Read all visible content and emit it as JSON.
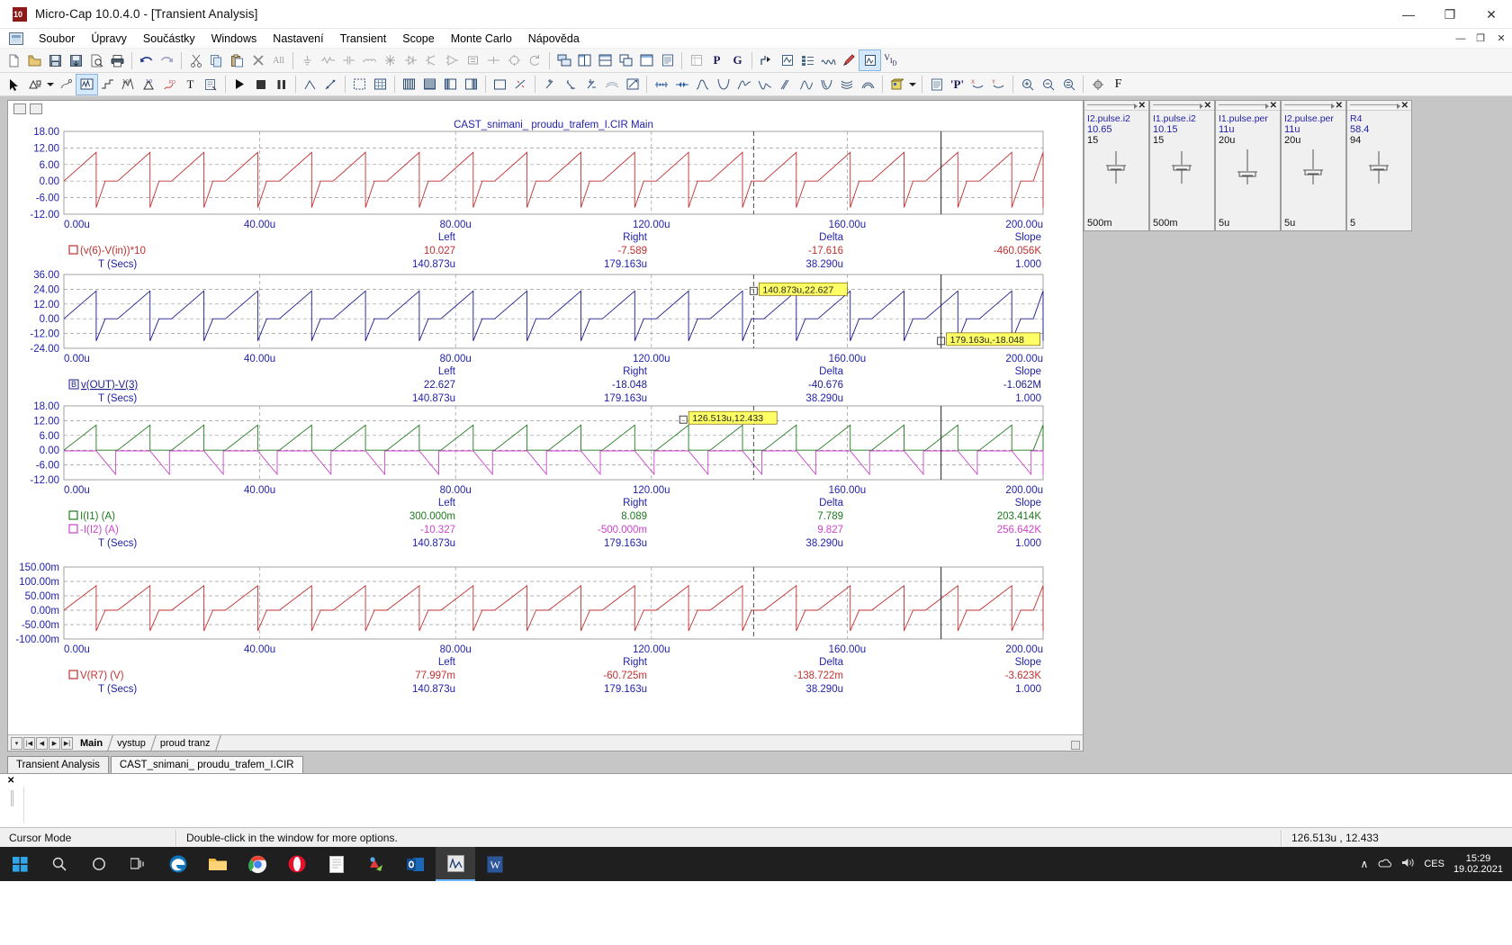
{
  "window": {
    "title": "Micro-Cap 10.0.4.0 - [Transient Analysis]",
    "app_icon": "microcap-icon",
    "minimize": "—",
    "maximize": "❐",
    "close": "✕",
    "inner_minimize": "—",
    "inner_restore": "❐",
    "inner_close": "✕"
  },
  "menu": {
    "items": [
      {
        "label": "Soubor",
        "name": "menu-soubor"
      },
      {
        "label": "Úpravy",
        "name": "menu-upravy"
      },
      {
        "label": "Součástky",
        "name": "menu-soucastky"
      },
      {
        "label": "Windows",
        "name": "menu-windows"
      },
      {
        "label": "Nastavení",
        "name": "menu-nastaveni"
      },
      {
        "label": "Transient",
        "name": "menu-transient"
      },
      {
        "label": "Scope",
        "name": "menu-scope"
      },
      {
        "label": "Monte Carlo",
        "name": "menu-montecarlo"
      },
      {
        "label": "Nápověda",
        "name": "menu-napoveda"
      }
    ]
  },
  "toolbar_labels": {
    "p": "P",
    "g": "G",
    "vid": "V",
    "vid_sub": "I",
    "vid_sub2": "D",
    "f": "F",
    "pquote": "'P'"
  },
  "plot_window": {
    "title": "CAST_snimani_ proudu_trafem_I.CIR Main"
  },
  "chart_data": [
    {
      "id": "plot1",
      "type": "line",
      "title": "CAST_snimani_ proudu_trafem_I.CIR Main",
      "xlabel": "T (Secs)",
      "ylabel": "",
      "ylim": [
        -12,
        18
      ],
      "yticks": [
        "18.00",
        "12.00",
        "6.00",
        "0.00",
        "-6.00",
        "-12.00"
      ],
      "ytick_values": [
        18,
        12,
        6,
        0,
        -6,
        -12
      ],
      "xlim": [
        0,
        200
      ],
      "xticks": [
        "0.00u",
        "40.00u",
        "80.00u",
        "120.00u",
        "160.00u",
        "200.00u"
      ],
      "xtick_values": [
        0,
        40,
        80,
        120,
        160,
        200
      ],
      "series": [
        {
          "name": "(v(6)-V(in))*10",
          "color": "#c03030",
          "period_us": 11,
          "rise_peak": 10.4,
          "fall_min": -9.6,
          "waveform": "sawtooth-pulse"
        }
      ],
      "readout": {
        "columns": [
          "Left",
          "Right",
          "Delta",
          "Slope"
        ],
        "rows": [
          {
            "label": "(v(6)-V(in))*10",
            "color": "#c03030",
            "marker": "square",
            "values": [
              "10.027",
              "-7.589",
              "-17.616",
              "-460.056K"
            ]
          },
          {
            "label": "T (Secs)",
            "color": "#2222aa",
            "marker": "none",
            "values": [
              "140.873u",
              "179.163u",
              "38.290u",
              "1.000"
            ]
          }
        ]
      }
    },
    {
      "id": "plot2",
      "type": "line",
      "title": "",
      "xlabel": "T (Secs)",
      "ylim": [
        -24,
        36
      ],
      "yticks": [
        "36.00",
        "24.00",
        "12.00",
        "0.00",
        "-12.00",
        "-24.00"
      ],
      "ytick_values": [
        36,
        24,
        12,
        0,
        -12,
        -24
      ],
      "xlim": [
        0,
        200
      ],
      "xticks": [
        "0.00u",
        "40.00u",
        "80.00u",
        "120.00u",
        "160.00u",
        "200.00u"
      ],
      "xtick_values": [
        0,
        40,
        80,
        120,
        160,
        200
      ],
      "series": [
        {
          "name": "v(OUT)-V(3)",
          "color": "#1a1a8c",
          "period_us": 11,
          "rise_peak": 22.6,
          "fall_min": -18.0,
          "waveform": "sawtooth-pulse"
        }
      ],
      "cursor_tooltips": [
        {
          "text": "140.873u,22.627",
          "x_us": 140.873,
          "y": 22.627,
          "name": "left-cursor-tooltip"
        },
        {
          "text": "179.163u,-18.048",
          "x_us": 179.163,
          "y": -18.048,
          "name": "right-cursor-tooltip"
        }
      ],
      "readout": {
        "columns": [
          "Left",
          "Right",
          "Delta",
          "Slope"
        ],
        "rows": [
          {
            "label": "v(OUT)-V(3)",
            "color": "#1a1a8c",
            "marker": "boxed-B",
            "values": [
              "22.627",
              "-18.048",
              "-40.676",
              "-1.062M"
            ]
          },
          {
            "label": "T (Secs)",
            "color": "#2222aa",
            "marker": "none",
            "values": [
              "140.873u",
              "179.163u",
              "38.290u",
              "1.000"
            ]
          }
        ]
      }
    },
    {
      "id": "plot3",
      "type": "line",
      "xlabel": "T (Secs)",
      "ylim": [
        -12,
        18
      ],
      "yticks": [
        "18.00",
        "12.00",
        "6.00",
        "0.00",
        "-6.00",
        "-12.00"
      ],
      "ytick_values": [
        18,
        12,
        6,
        0,
        -6,
        -12
      ],
      "xlim": [
        0,
        200
      ],
      "xticks": [
        "0.00u",
        "40.00u",
        "80.00u",
        "120.00u",
        "160.00u",
        "200.00u"
      ],
      "xtick_values": [
        0,
        40,
        80,
        120,
        160,
        200
      ],
      "series": [
        {
          "name": "I(I1) (A)",
          "color": "#1f7a1f",
          "period_us": 11,
          "rise_peak": 10.2,
          "fall_min": 0.0,
          "waveform": "sawtooth-positive"
        },
        {
          "name": "-I(I2) (A)",
          "color": "#cc44cc",
          "period_us": 11,
          "rise_peak": 0.0,
          "fall_min": -9.8,
          "waveform": "sawtooth-negative"
        }
      ],
      "cursor_tooltips": [
        {
          "text": "126.513u,12.433",
          "x_us": 126.513,
          "y": 12.433,
          "name": "hover-cursor-tooltip"
        }
      ],
      "readout": {
        "columns": [
          "Left",
          "Right",
          "Delta",
          "Slope"
        ],
        "rows": [
          {
            "label": "I(I1) (A)",
            "color": "#1f7a1f",
            "marker": "square",
            "values": [
              "300.000m",
              "8.089",
              "7.789",
              "203.414K"
            ]
          },
          {
            "label": "-I(I2) (A)",
            "color": "#cc44cc",
            "marker": "square",
            "values": [
              "-10.327",
              "-500.000m",
              "9.827",
              "256.642K"
            ]
          },
          {
            "label": "T (Secs)",
            "color": "#2222aa",
            "marker": "none",
            "values": [
              "140.873u",
              "179.163u",
              "38.290u",
              "1.000"
            ]
          }
        ]
      }
    },
    {
      "id": "plot4",
      "type": "line",
      "xlabel": "T (Secs)",
      "ylim": [
        -0.1,
        0.15
      ],
      "yticks": [
        "150.00m",
        "100.00m",
        "50.00m",
        "0.00m",
        "-50.00m",
        "-100.00m"
      ],
      "ytick_values": [
        0.15,
        0.1,
        0.05,
        0.0,
        -0.05,
        -0.1
      ],
      "xlim": [
        0,
        200
      ],
      "xticks": [
        "0.00u",
        "40.00u",
        "80.00u",
        "120.00u",
        "160.00u",
        "200.00u"
      ],
      "xtick_values": [
        0,
        40,
        80,
        120,
        160,
        200
      ],
      "series": [
        {
          "name": "V(R7) (V)",
          "color": "#c03030",
          "period_us": 11,
          "rise_peak": 0.085,
          "fall_min": -0.072,
          "waveform": "sawtooth-pulse"
        }
      ],
      "readout": {
        "columns": [
          "Left",
          "Right",
          "Delta",
          "Slope"
        ],
        "rows": [
          {
            "label": "V(R7) (V)",
            "color": "#c03030",
            "marker": "square",
            "values": [
              "77.997m",
              "-60.725m",
              "-138.722m",
              "-3.623K"
            ]
          },
          {
            "label": "T (Secs)",
            "color": "#2222aa",
            "marker": "none",
            "values": [
              "140.873u",
              "179.163u",
              "38.290u",
              "1.000"
            ]
          }
        ]
      }
    }
  ],
  "page_tabs": {
    "nav": [
      "▾",
      "|◀",
      "◀",
      "▶",
      "▶|"
    ],
    "items": [
      {
        "label": "Main",
        "selected": true
      },
      {
        "label": "vystup",
        "selected": false
      },
      {
        "label": "proud tranz",
        "selected": false
      }
    ]
  },
  "analysis_tabs": [
    {
      "label": "Transient Analysis",
      "selected": false
    },
    {
      "label": "CAST_snimani_ proudu_trafem_I.CIR",
      "selected": true
    }
  ],
  "component_panels": [
    {
      "name": "I2.pulse.i2",
      "value": "10.65",
      "max": "15",
      "foot": "500m"
    },
    {
      "name": "I1.pulse.i2",
      "value": "10.15",
      "max": "15",
      "foot": "500m"
    },
    {
      "name": "I1.pulse.per",
      "value": "11u",
      "max": "20u",
      "foot": "5u"
    },
    {
      "name": "I2.pulse.per",
      "value": "11u",
      "max": "20u",
      "foot": "5u"
    },
    {
      "name": "R4",
      "value": "58.4",
      "max": "94",
      "foot": "5"
    }
  ],
  "status_bar": {
    "mode": "Cursor Mode",
    "hint": "Double-click in the window for more options.",
    "coords": "126.513u , 12.433"
  },
  "taskbar": {
    "start": "start-icon",
    "search": "search-icon",
    "cortana": "cortana-icon",
    "taskview": "task-view-icon",
    "apps": [
      {
        "name": "edge-icon",
        "color": "#0f8fd8"
      },
      {
        "name": "file-explorer-icon",
        "color": "#ffb900"
      },
      {
        "name": "chrome-icon",
        "color": "#4285f4"
      },
      {
        "name": "opera-icon",
        "color": "#e8112d"
      },
      {
        "name": "notepad-icon",
        "color": "#ffffff"
      },
      {
        "name": "paint-3d-icon",
        "color": "#e33b3b"
      },
      {
        "name": "outlook-icon",
        "color": "#0f6cbd"
      },
      {
        "name": "microcap-icon",
        "color": "#d8d8d8"
      },
      {
        "name": "word-icon",
        "color": "#2b579a"
      }
    ],
    "tray": {
      "chevron": "∧",
      "onedrive": "onedrive-icon",
      "volume": "volume-icon",
      "language": "CES",
      "time": "15:29",
      "date": "19.02.2021"
    }
  }
}
